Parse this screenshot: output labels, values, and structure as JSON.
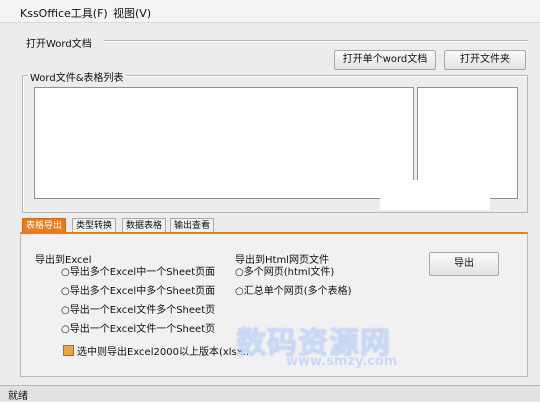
{
  "menu": {
    "tools_label": "KssOffice工具(F)",
    "view_label": "视图(V)"
  },
  "open_word": {
    "title": "打开Word文档",
    "open_single_label": "打开单个word文档",
    "open_folder_label": "打开文件夹"
  },
  "list_section": {
    "title": "Word文件&表格列表"
  },
  "tabs": [
    {
      "label": "表格导出",
      "active": true
    },
    {
      "label": "类型转换",
      "active": false
    },
    {
      "label": "数据表格",
      "active": false
    },
    {
      "label": "输出查看",
      "active": false
    }
  ],
  "export_excel": {
    "title": "导出到Excel",
    "options": [
      "○导出多个Excel中一个Sheet页面",
      "○导出多个Excel中多个Sheet页面",
      "○导出一个Excel文件多个Sheet页",
      "○导出一个Excel文件一个Sheet页"
    ]
  },
  "export_html": {
    "title": "导出到Html网页文件",
    "options": [
      "○多个网页(html文件)",
      "○汇总单个网页(多个表格)"
    ]
  },
  "export_button_label": "导出",
  "excel2000_checkbox": {
    "label": "选中则导出Excel2000以上版本(xlsx...",
    "checked": true
  },
  "status_text": "就绪",
  "watermark": {
    "main": "数码资源网",
    "url": "www.smzy.com"
  },
  "colors": {
    "active_tab": "#e87b1a",
    "watermark": "#c9d9f5"
  }
}
